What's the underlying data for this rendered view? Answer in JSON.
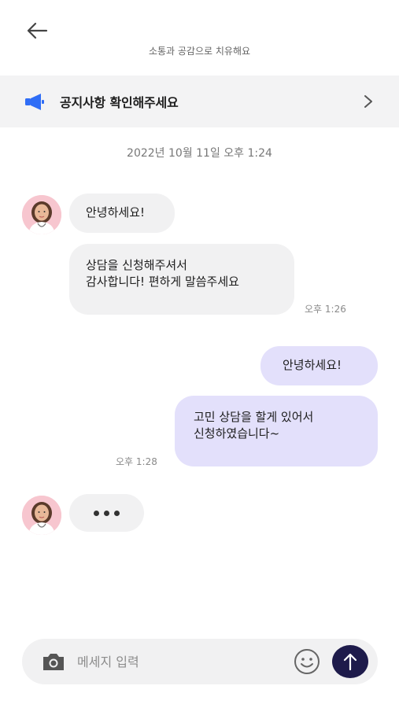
{
  "header": {
    "back_icon": "arrow-left-icon",
    "subtitle": "소통과 공감으로 치유해요"
  },
  "notice": {
    "icon": "megaphone-icon",
    "label": "공지사항 확인해주세요",
    "chevron_icon": "chevron-right-icon",
    "icon_color": "#2f6df6"
  },
  "chat": {
    "date": "2022년 10월 11일 오후 1:24",
    "messages": [
      {
        "from": "counselor",
        "text": "안녕하세요!"
      },
      {
        "from": "counselor",
        "text": "상담을 신청해주셔서\n감사합니다! 편하게 말씀주세요",
        "time": "오후 1:26"
      },
      {
        "from": "me",
        "text": "안녕하세요!"
      },
      {
        "from": "me",
        "text": "고민 상담을 할게 있어서\n신청하였습니다~",
        "time": "오후 1:28"
      }
    ],
    "typing_indicator": "•••"
  },
  "composer": {
    "camera_icon": "camera-icon",
    "placeholder": "메세지 입력",
    "value": "",
    "emoji_icon": "smiley-icon",
    "send_icon": "arrow-up-icon",
    "send_color": "#1e1b4b"
  },
  "colors": {
    "incoming_bubble": "#f1f1f2",
    "outgoing_bubble": "#e3e0fb",
    "notice_bg": "#f3f3f4"
  }
}
